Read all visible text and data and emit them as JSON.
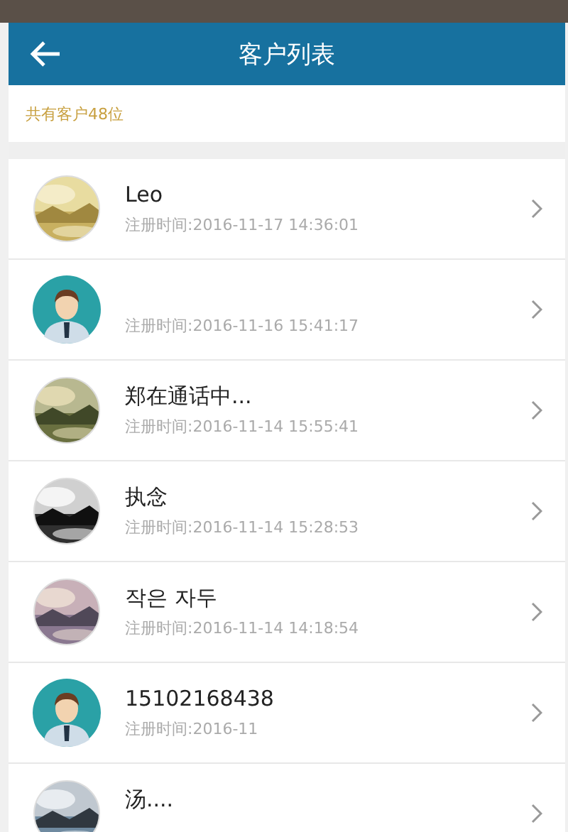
{
  "header": {
    "title": "客户列表"
  },
  "summary": "共有客户48位",
  "customers": [
    {
      "name": "Leo",
      "registered": "注册时间:2016-11-17 14:36:01",
      "kind": "picture"
    },
    {
      "registered": "注册时间:2016-11-16 15:41:17",
      "kind": "default"
    },
    {
      "name": "郑在通话中...",
      "registered": "注册时间:2016-11-14 15:55:41",
      "kind": "picture"
    },
    {
      "name": "执念",
      "registered": "注册时间:2016-11-14 15:28:53",
      "kind": "picture"
    },
    {
      "name": "작은 자두",
      "registered": "注册时间:2016-11-14 14:18:54",
      "kind": "picture"
    },
    {
      "name": "15102168438",
      "registered": "注册时间:2016-11",
      "kind": "default"
    },
    {
      "name": "汤....",
      "kind": "picture"
    }
  ]
}
